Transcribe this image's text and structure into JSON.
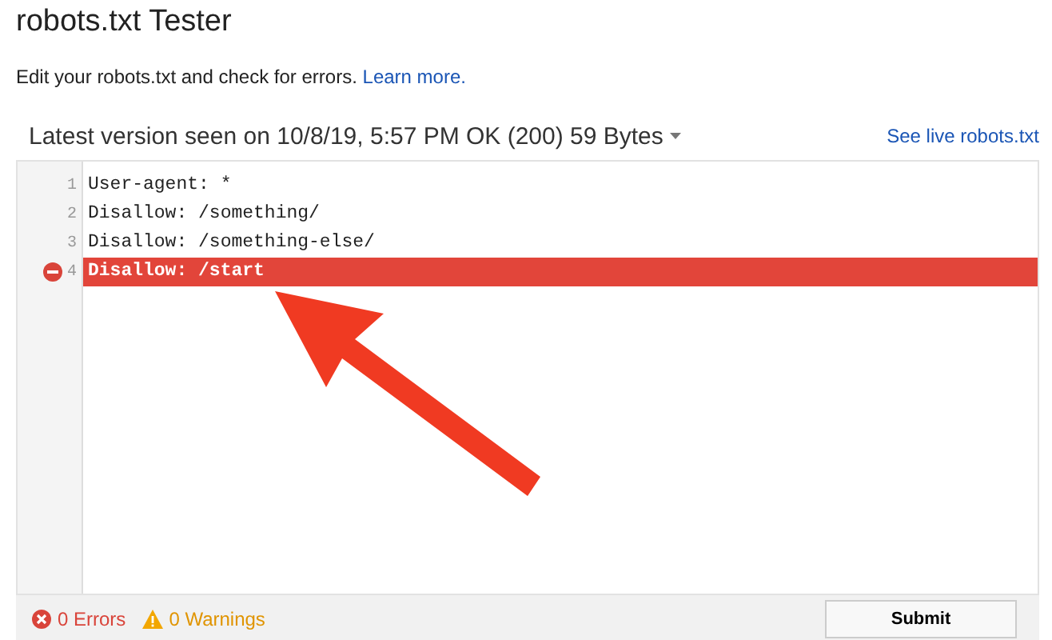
{
  "title": "robots.txt Tester",
  "description": {
    "text": "Edit your robots.txt and check for errors.",
    "link": "Learn more."
  },
  "version": {
    "label": "Latest version seen on 10/8/19, 5:57 PM OK (200) 59 Bytes",
    "live_link": "See live robots.txt"
  },
  "editor": {
    "lines": [
      {
        "number": "1",
        "text": "User-agent: *",
        "error": false
      },
      {
        "number": "2",
        "text": "Disallow: /something/",
        "error": false
      },
      {
        "number": "3",
        "text": "Disallow: /something-else/",
        "error": false
      },
      {
        "number": "4",
        "text": "Disallow: /start",
        "error": true
      }
    ]
  },
  "footer": {
    "errors": "0 Errors",
    "warnings": "0 Warnings",
    "button": "Submit"
  }
}
